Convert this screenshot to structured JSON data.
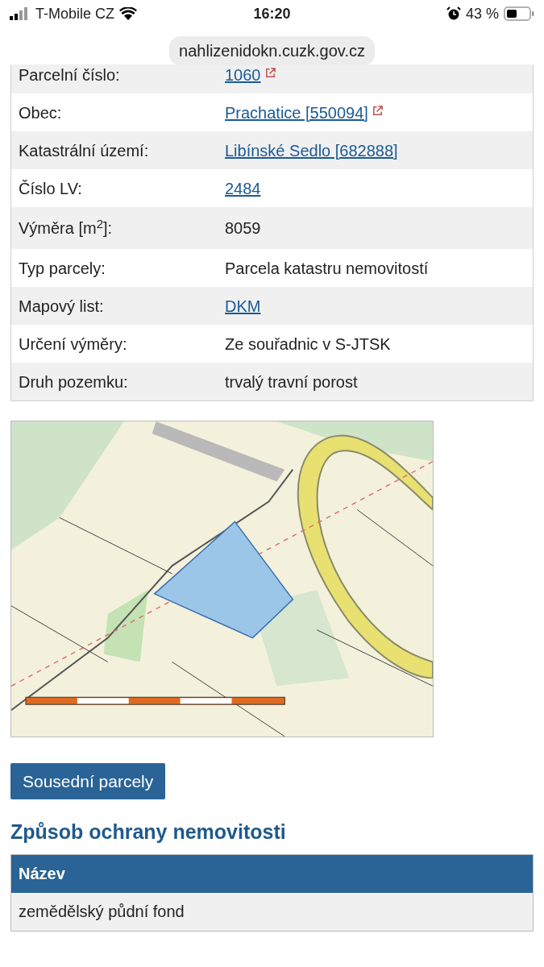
{
  "status_bar": {
    "carrier": "T-Mobile CZ",
    "time": "16:20",
    "battery": "43 %"
  },
  "address_bar": {
    "url": "nahlizenidokn.cuzk.gov.cz"
  },
  "parcel_table": {
    "rows": [
      {
        "label": "Parcelní číslo:",
        "value": "1060",
        "kind": "link",
        "external": true
      },
      {
        "label": "Obec:",
        "value": "Prachatice [550094]",
        "kind": "link",
        "external": true
      },
      {
        "label": "Katastrální území:",
        "value": "Libínské Sedlo [682888]",
        "kind": "link",
        "external": false
      },
      {
        "label": "Číslo LV:",
        "value": "2484",
        "kind": "link",
        "external": false
      },
      {
        "label": "Výměra [m$^{2}$]:",
        "value": "8059",
        "kind": "text",
        "external": false
      },
      {
        "label": "Typ parcely:",
        "value": "Parcela katastru nemovitostí",
        "kind": "text",
        "external": false
      },
      {
        "label": "Mapový list:",
        "value": "DKM",
        "kind": "link",
        "external": false
      },
      {
        "label": "Určení výměry:",
        "value": "Ze souřadnic v S-JTSK",
        "kind": "text",
        "external": false
      },
      {
        "label": "Druh pozemku:",
        "value": "trvalý travní porost",
        "kind": "text",
        "external": false
      }
    ]
  },
  "neighbors_button": "Sousední parcely",
  "protection": {
    "heading": "Způsob ochrany nemovitosti",
    "columns": [
      "Název"
    ],
    "rows": [
      [
        "zemědělský půdní fond"
      ]
    ]
  }
}
